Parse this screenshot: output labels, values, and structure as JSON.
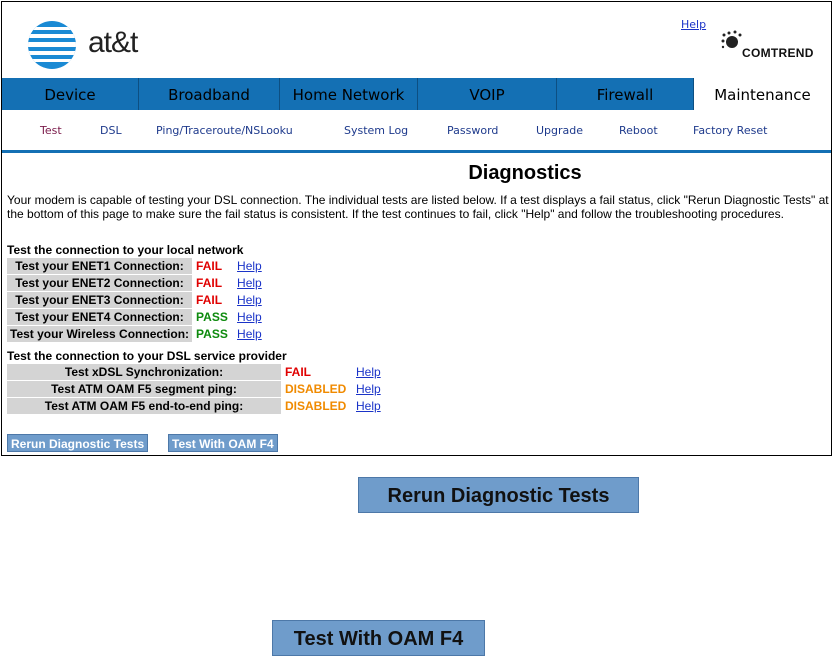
{
  "brand": {
    "logo_text": "at&t",
    "vendor": "COMTREND",
    "help_label": "Help"
  },
  "main_nav": [
    {
      "label": "Device"
    },
    {
      "label": "Broadband"
    },
    {
      "label": "Home Network"
    },
    {
      "label": "VOIP"
    },
    {
      "label": "Firewall"
    },
    {
      "label": "Maintenance",
      "active": true
    }
  ],
  "sub_nav": [
    {
      "label": "Test",
      "active": true
    },
    {
      "label": "DSL"
    },
    {
      "label": "Ping/Traceroute/NSLooku"
    },
    {
      "label": "System Log"
    },
    {
      "label": "Password"
    },
    {
      "label": "Upgrade"
    },
    {
      "label": "Reboot"
    },
    {
      "label": "Factory Reset"
    }
  ],
  "page": {
    "title": "Diagnostics",
    "intro": "Your modem is capable of testing your DSL connection. The individual tests are listed below. If a test displays a fail status, click \"Rerun Diagnostic Tests\" at the bottom of this page to make sure the fail status is consistent. If the test continues to fail, click \"Help\" and follow the troubleshooting procedures."
  },
  "local_section": {
    "heading": "Test the connection to your local network",
    "rows": [
      {
        "label": "Test your ENET1 Connection:",
        "status": "FAIL",
        "help": "Help"
      },
      {
        "label": "Test your ENET2 Connection:",
        "status": "FAIL",
        "help": "Help"
      },
      {
        "label": "Test your ENET3 Connection:",
        "status": "FAIL",
        "help": "Help"
      },
      {
        "label": "Test your ENET4 Connection:",
        "status": "PASS",
        "help": "Help"
      },
      {
        "label": "Test your Wireless Connection:",
        "status": "PASS",
        "help": "Help"
      }
    ]
  },
  "dsl_section": {
    "heading": "Test the connection to your DSL service provider",
    "rows": [
      {
        "label": "Test xDSL Synchronization:",
        "status": "FAIL",
        "help": "Help"
      },
      {
        "label": "Test ATM OAM F5 segment ping:",
        "status": "DISABLED",
        "help": "Help"
      },
      {
        "label": "Test ATM OAM F5 end-to-end ping:",
        "status": "DISABLED",
        "help": "Help"
      }
    ]
  },
  "buttons": {
    "rerun": "Rerun Diagnostic Tests",
    "oam_f4": "Test With OAM F4"
  },
  "colors": {
    "nav_blue": "#1470b4",
    "fail": "#e00000",
    "pass": "#0d8a0d",
    "disabled": "#f08a00",
    "button": "#6f9ccb"
  }
}
